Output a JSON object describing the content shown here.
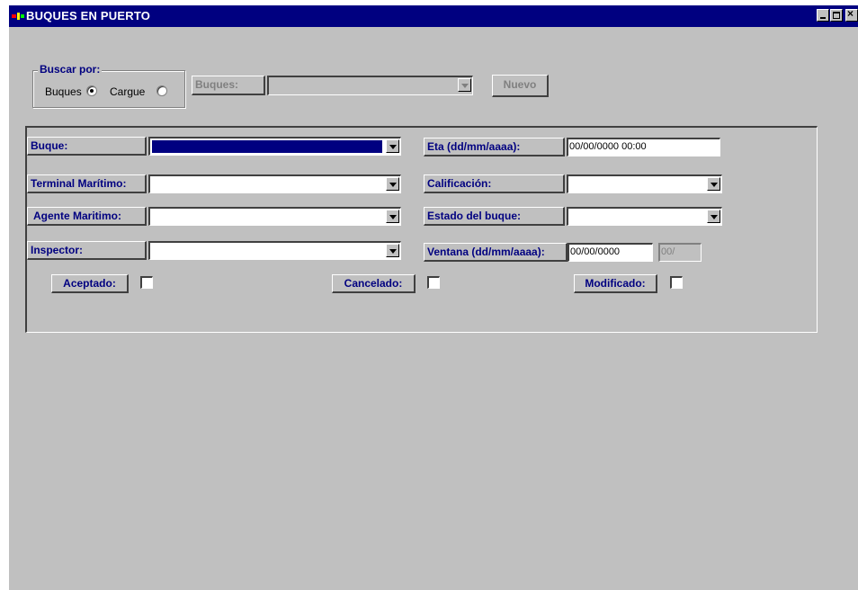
{
  "window": {
    "title": "BUQUES EN PUERTO",
    "controls": [
      "minimize",
      "maximize",
      "close"
    ]
  },
  "search": {
    "group_label": "Buscar por:",
    "options": [
      {
        "label": "Buques",
        "selected": true
      },
      {
        "label": "Cargue",
        "selected": false
      }
    ],
    "field_label": "Buques:",
    "combo_value": "",
    "new_button": "Nuevo"
  },
  "form": {
    "buque": {
      "label": "Buque:",
      "value": ""
    },
    "terminal": {
      "label": "Terminal Marítimo:",
      "value": ""
    },
    "agente": {
      "label": "Agente Maritimo:",
      "value": ""
    },
    "inspector": {
      "label": "Inspector:",
      "value": ""
    },
    "eta": {
      "label": "Eta (dd/mm/aaaa):",
      "value": "00/00/0000 00:00"
    },
    "calificacion": {
      "label": "Calificación:",
      "value": ""
    },
    "estado": {
      "label": "Estado del buque:",
      "value": ""
    },
    "ventana": {
      "label": "Ventana (dd/mm/aaaa):",
      "value": "00/00/0000",
      "value2": "00/"
    },
    "aceptado": {
      "label": "Aceptado:",
      "checked": false
    },
    "cancelado": {
      "label": "Cancelado:",
      "checked": false
    },
    "modificado": {
      "label": "Modificado:",
      "checked": false
    }
  },
  "colors": {
    "titlebar": "#000080",
    "label_text": "#000080",
    "window_bg": "#c0c0c0"
  }
}
